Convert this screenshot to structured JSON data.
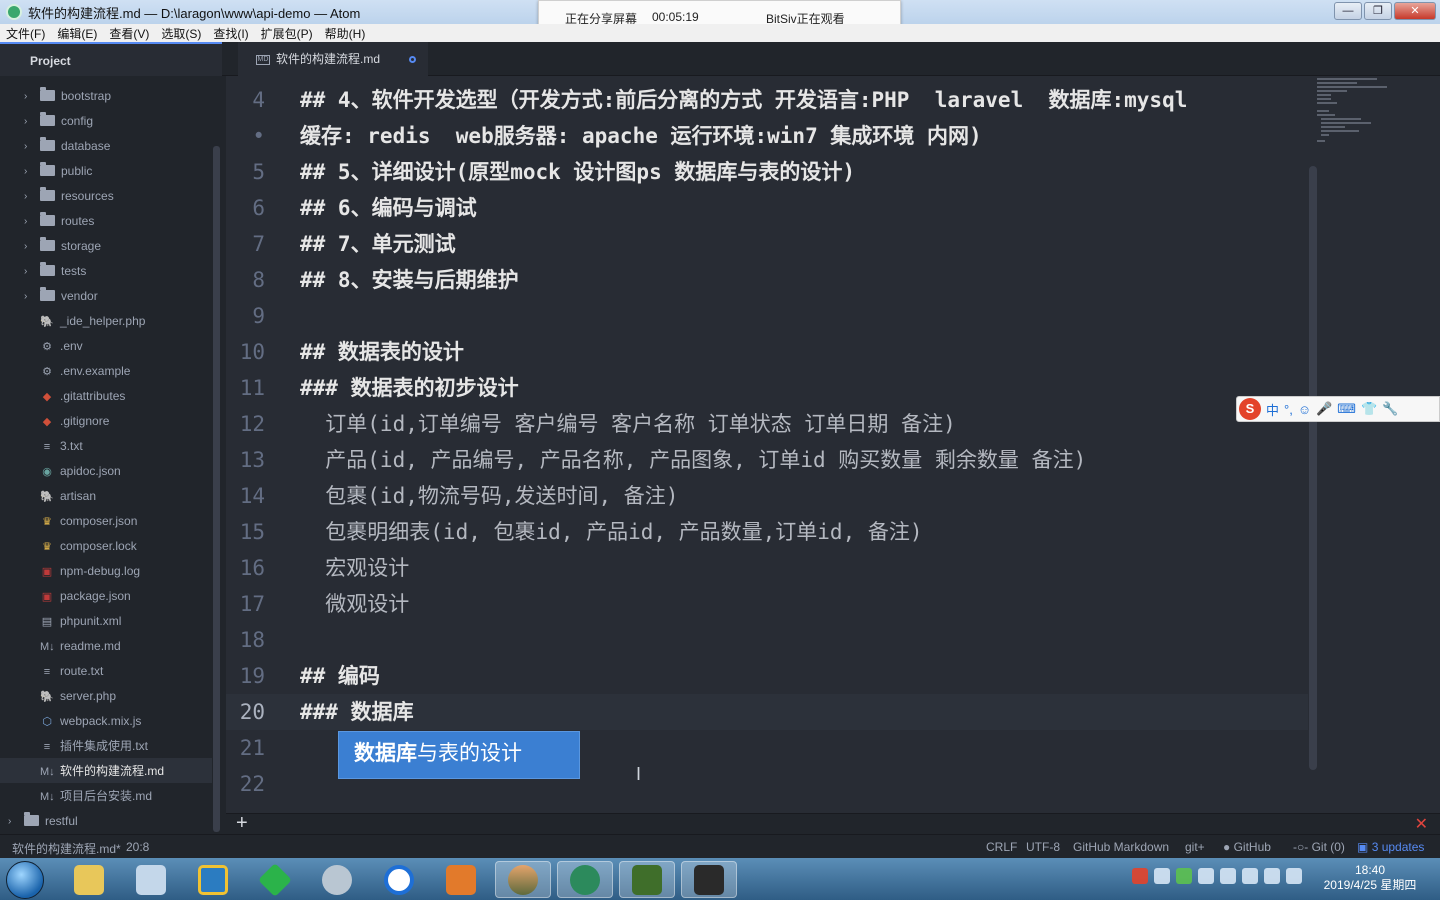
{
  "window": {
    "title": "软件的构建流程.md — D:\\laragon\\www\\api-demo — Atom",
    "buttons": {
      "minimize": "—",
      "maximize": "❐",
      "close": "✕"
    }
  },
  "share_banner": {
    "status": "正在分享屏幕",
    "time": "00:05:19",
    "viewer": "BitSiv正在观看"
  },
  "menu": [
    "文件(F)",
    "编辑(E)",
    "查看(V)",
    "选取(S)",
    "查找(I)",
    "扩展包(P)",
    "帮助(H)"
  ],
  "tree_header": "Project",
  "tab": {
    "label": "软件的构建流程.md",
    "icon": "MD"
  },
  "tree": {
    "folders": [
      "bootstrap",
      "config",
      "database",
      "public",
      "resources",
      "routes",
      "storage",
      "tests",
      "vendor"
    ],
    "files": [
      {
        "name": "_ide_helper.php",
        "icon": "php-icon"
      },
      {
        "name": ".env",
        "icon": "gear-icon"
      },
      {
        "name": ".env.example",
        "icon": "gear-icon"
      },
      {
        "name": ".gitattributes",
        "icon": "git-icon"
      },
      {
        "name": ".gitignore",
        "icon": "git-icon"
      },
      {
        "name": "3.txt",
        "icon": "text-file-icon"
      },
      {
        "name": "apidoc.json",
        "icon": "json-icon"
      },
      {
        "name": "artisan",
        "icon": "php-icon"
      },
      {
        "name": "composer.json",
        "icon": "composer-icon"
      },
      {
        "name": "composer.lock",
        "icon": "composer-icon"
      },
      {
        "name": "npm-debug.log",
        "icon": "npm-icon"
      },
      {
        "name": "package.json",
        "icon": "npm-icon"
      },
      {
        "name": "phpunit.xml",
        "icon": "xml-icon"
      },
      {
        "name": "readme.md",
        "icon": "markdown-icon"
      },
      {
        "name": "route.txt",
        "icon": "text-file-icon"
      },
      {
        "name": "server.php",
        "icon": "php-icon"
      },
      {
        "name": "webpack.mix.js",
        "icon": "webpack-icon"
      },
      {
        "name": "插件集成使用.txt",
        "icon": "text-file-icon"
      },
      {
        "name": "软件的构建流程.md",
        "icon": "markdown-icon"
      },
      {
        "name": "项目后台安装.md",
        "icon": "markdown-icon"
      }
    ],
    "root_folder": "restful"
  },
  "editor": {
    "lines": [
      {
        "num": "4",
        "text": "## 4、软件开发选型（开发方式:前后分离的方式 开发语言:PHP  laravel  数据库:mysql",
        "dim": false
      },
      {
        "num": "•",
        "text": "缓存: redis  web服务器: apache 运行环境:win7 集成环境 内网)",
        "dim": false
      },
      {
        "num": "5",
        "text": "## 5、详细设计(原型mock 设计图ps 数据库与表的设计)",
        "dim": false
      },
      {
        "num": "6",
        "text": "## 6、编码与调试",
        "dim": false
      },
      {
        "num": "7",
        "text": "## 7、单元测试",
        "dim": false
      },
      {
        "num": "8",
        "text": "## 8、安装与后期维护",
        "dim": false
      },
      {
        "num": "9",
        "text": "",
        "dim": false
      },
      {
        "num": "10",
        "text": "## 数据表的设计",
        "dim": false
      },
      {
        "num": "11",
        "text": "### 数据表的初步设计",
        "dim": false
      },
      {
        "num": "12",
        "text": "  订单(id,订单编号 客户编号 客户名称 订单状态 订单日期 备注)",
        "dim": true
      },
      {
        "num": "13",
        "text": "  产品(id, 产品编号, 产品名称, 产品图象, 订单id 购买数量 剩余数量 备注)",
        "dim": true
      },
      {
        "num": "14",
        "text": "  包裹(id,物流号码,发送时间, 备注)",
        "dim": true
      },
      {
        "num": "15",
        "text": "  包裹明细表(id, 包裹id, 产品id, 产品数量,订单id, 备注)",
        "dim": true
      },
      {
        "num": "16",
        "text": "  宏观设计",
        "dim": true
      },
      {
        "num": "17",
        "text": "  微观设计",
        "dim": true
      },
      {
        "num": "18",
        "text": "",
        "dim": false
      },
      {
        "num": "19",
        "text": "## 编码",
        "dim": false
      },
      {
        "num": "20",
        "text": "### 数据库",
        "dim": false
      },
      {
        "num": "21",
        "text": "",
        "dim": false
      },
      {
        "num": "22",
        "text": "",
        "dim": false
      }
    ],
    "highlight": {
      "bold": "数据库",
      "rest": "与表的设计"
    }
  },
  "ime": {
    "logo": "S",
    "items": [
      "中",
      "°,",
      "☺",
      "🎤",
      "⌨",
      "👕",
      "🔧"
    ]
  },
  "status": {
    "file": "软件的构建流程.md*",
    "cursor": "20:8",
    "line_ending": "CRLF",
    "encoding": "UTF-8",
    "grammar": "GitHub Markdown",
    "git": "git+",
    "github": "GitHub",
    "git_count": "Git (0)",
    "updates": "3 updates"
  },
  "clock": {
    "time": "18:40",
    "date": "2019/4/25 星期四"
  }
}
